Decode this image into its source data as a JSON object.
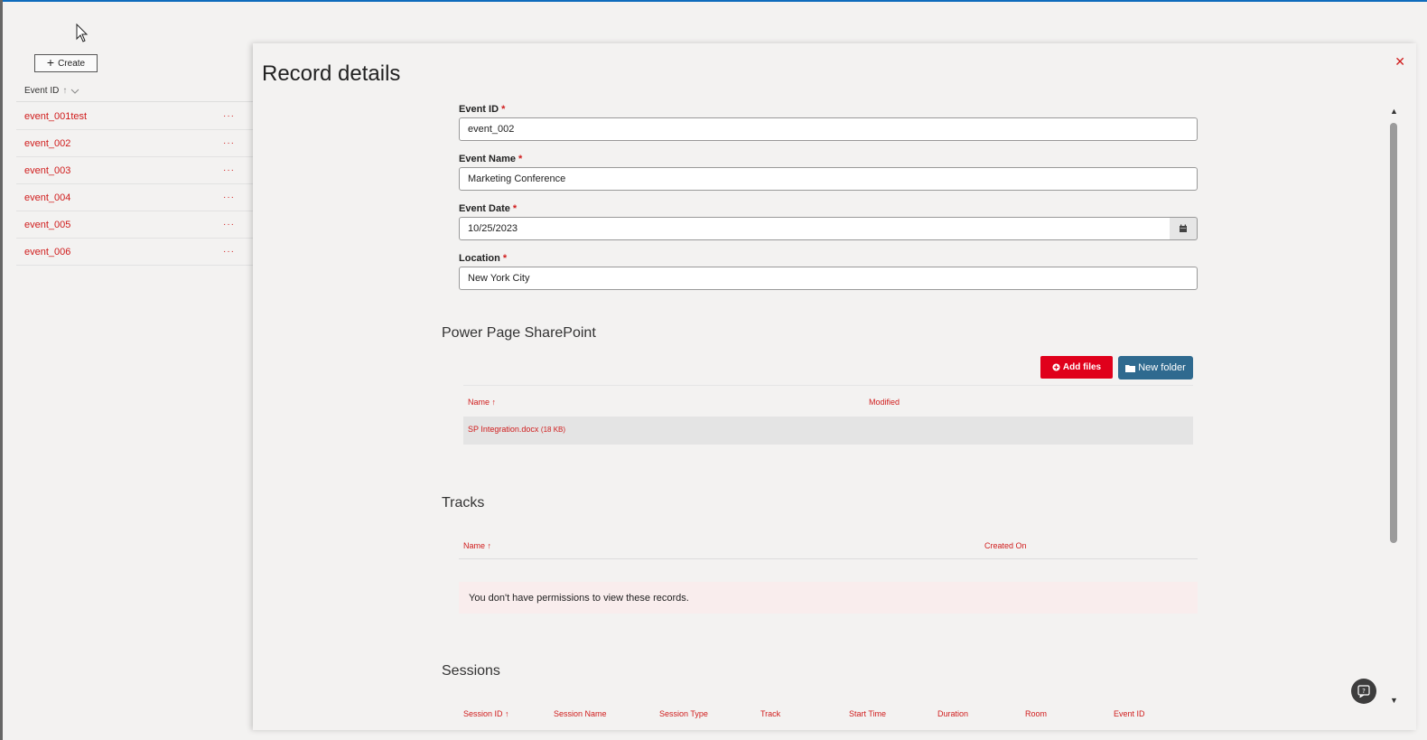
{
  "toolbar": {
    "create_label": "Create"
  },
  "list": {
    "column_header": "Event ID",
    "rows": [
      {
        "id": "event_001test"
      },
      {
        "id": "event_002"
      },
      {
        "id": "event_003"
      },
      {
        "id": "event_004"
      },
      {
        "id": "event_005"
      },
      {
        "id": "event_006"
      }
    ],
    "more_label": "···"
  },
  "panel": {
    "title": "Record details",
    "close_label": "✕",
    "fields": {
      "event_id": {
        "label": "Event ID",
        "value": "event_002"
      },
      "event_name": {
        "label": "Event Name",
        "value": "Marketing Conference"
      },
      "event_date": {
        "label": "Event Date",
        "value": "10/25/2023"
      },
      "location": {
        "label": "Location",
        "value": "New York City"
      }
    },
    "required_mark": "*",
    "sharepoint": {
      "title": "Power Page SharePoint",
      "add_files_label": "Add files",
      "new_folder_label": "New folder",
      "col_name": "Name",
      "col_modified": "Modified",
      "files": [
        {
          "name": "SP Integration.docx",
          "size": "(18 KB)"
        }
      ]
    },
    "tracks": {
      "title": "Tracks",
      "col_name": "Name",
      "col_created": "Created On",
      "message": "You don't have permissions to view these records."
    },
    "sessions": {
      "title": "Sessions",
      "columns": [
        "Session ID",
        "Session Name",
        "Session Type",
        "Track",
        "Start Time",
        "Duration",
        "Room",
        "Event ID"
      ]
    }
  },
  "colors": {
    "accent": "#d01c1c",
    "add_files": "#e0001b",
    "new_folder": "#2f6a8f"
  },
  "icons": [
    "cursor-icon",
    "plus-icon",
    "sort-up-icon",
    "chevron-down-icon",
    "close-icon",
    "calendar-icon",
    "plus-circle-icon",
    "folder-icon",
    "help-chat-icon"
  ]
}
